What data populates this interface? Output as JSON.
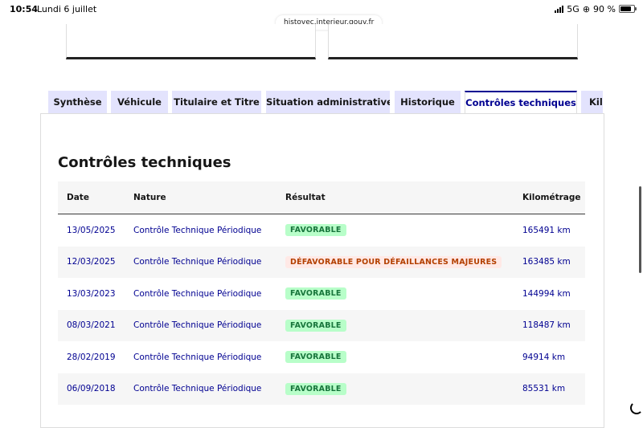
{
  "status": {
    "time": "10:54",
    "date": "Lundi 6 juillet",
    "network": "5G",
    "battery": "90 %",
    "battery_level": 0.9
  },
  "browser": {
    "url": "histovec.interieur.gouv.fr"
  },
  "tabs": [
    {
      "label": "Synthèse",
      "active": false
    },
    {
      "label": "Véhicule",
      "active": false
    },
    {
      "label": "Titulaire et Titre",
      "active": false
    },
    {
      "label": "Situation administrative",
      "active": false
    },
    {
      "label": "Historique",
      "active": false
    },
    {
      "label": "Contrôles techniques",
      "active": true
    },
    {
      "label": "Kilo",
      "active": false
    }
  ],
  "section": {
    "title": "Contrôles techniques",
    "headers": {
      "date": "Date",
      "nature": "Nature",
      "result": "Résultat",
      "km": "Kilométrage"
    },
    "rows": [
      {
        "date": "13/05/2025",
        "nature": "Contrôle Technique Périodique",
        "result": "FAVORABLE",
        "status": "ok",
        "km": "165491 km"
      },
      {
        "date": "12/03/2025",
        "nature": "Contrôle Technique Périodique",
        "result": "DÉFAVORABLE POUR DÉFAILLANCES MAJEURES",
        "status": "ko",
        "km": "163485 km"
      },
      {
        "date": "13/03/2023",
        "nature": "Contrôle Technique Périodique",
        "result": "FAVORABLE",
        "status": "ok",
        "km": "144994 km"
      },
      {
        "date": "08/03/2021",
        "nature": "Contrôle Technique Périodique",
        "result": "FAVORABLE",
        "status": "ok",
        "km": "118487 km"
      },
      {
        "date": "28/02/2019",
        "nature": "Contrôle Technique Périodique",
        "result": "FAVORABLE",
        "status": "ok",
        "km": "94914 km"
      },
      {
        "date": "06/09/2018",
        "nature": "Contrôle Technique Périodique",
        "result": "FAVORABLE",
        "status": "ok",
        "km": "85531 km"
      }
    ]
  },
  "colors": {
    "accent": "#000091",
    "tab_bg": "#e3e3fd",
    "success": "#18753c",
    "error": "#b34000"
  }
}
